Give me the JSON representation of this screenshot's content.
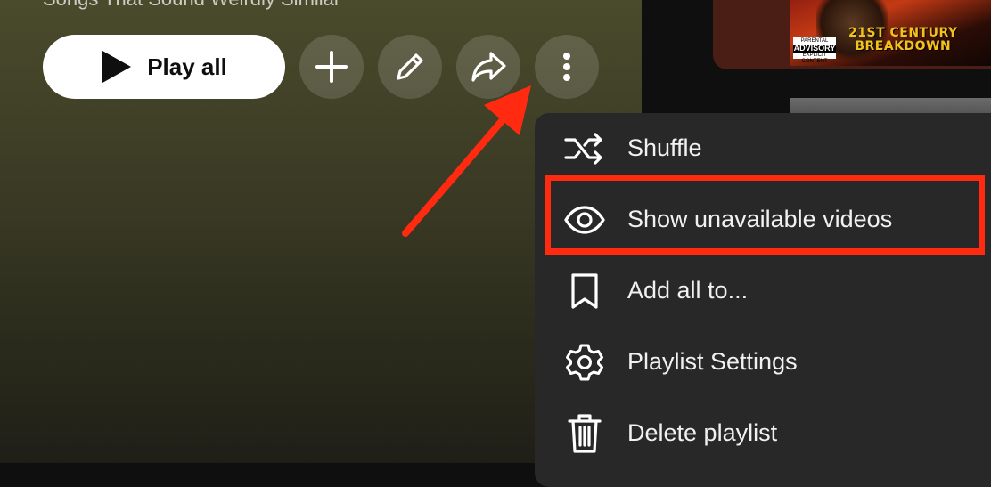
{
  "playlist": {
    "title": "Songs That Sound Weirdly Similar",
    "play_all_label": "Play all"
  },
  "actions": [
    {
      "name": "add-icon"
    },
    {
      "name": "edit-pencil-icon"
    },
    {
      "name": "share-icon"
    },
    {
      "name": "more-vertical-icon"
    }
  ],
  "album": {
    "advisory_top": "PARENTAL",
    "advisory_main": "ADVISORY",
    "advisory_bottom": "EXPLICIT CONTENT",
    "title_line1": "21ST CENTURY",
    "title_line2": "BREAKDOWN"
  },
  "menu": {
    "items": [
      {
        "label": "Shuffle",
        "icon": "shuffle-icon"
      },
      {
        "label": "Show unavailable videos",
        "icon": "eye-icon"
      },
      {
        "label": "Add all to...",
        "icon": "bookmark-icon"
      },
      {
        "label": "Playlist Settings",
        "icon": "gear-icon"
      },
      {
        "label": "Delete playlist",
        "icon": "trash-icon"
      }
    ]
  },
  "colors": {
    "annotation": "#ff2a10",
    "menu_bg": "#282828",
    "menu_text": "#f1f1f1"
  }
}
